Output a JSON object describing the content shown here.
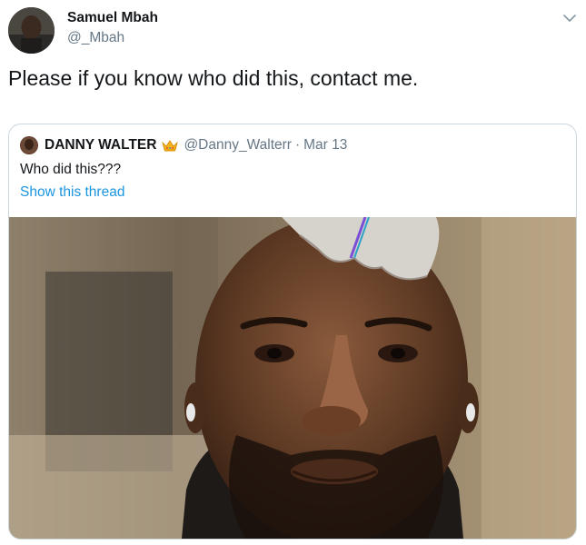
{
  "tweet": {
    "author_name": "Samuel Mbah",
    "author_handle": "@_Mbah",
    "text": "Please if you know who did this, contact me.",
    "menu_icon": "chevron-down-icon"
  },
  "quoted_tweet": {
    "author_name": "DANNY WALTER",
    "badge_icon": "crown-emoji-icon",
    "author_handle": "@Danny_Walterr",
    "separator": "·",
    "date": "Mar 13",
    "text": "Who did this???",
    "thread_link": "Show this thread"
  },
  "colors": {
    "text_primary": "#14171a",
    "text_secondary": "#657786",
    "link": "#1b95e0",
    "border": "#ccd6dd"
  }
}
